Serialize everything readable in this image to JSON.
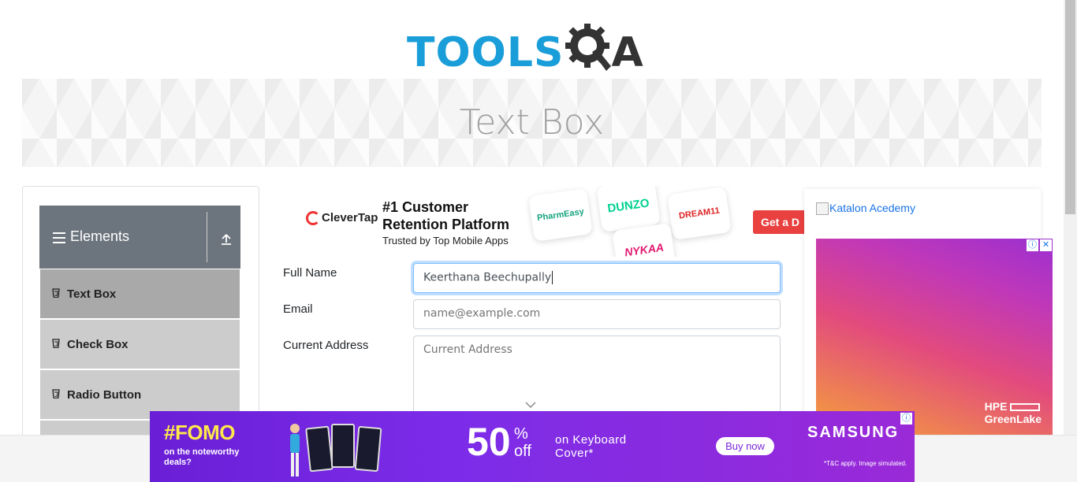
{
  "header": {
    "logo_tools": "TOOLS",
    "logo_qa": "QA",
    "brand_color": "#1a9ed9"
  },
  "banner": {
    "title": "Text Box"
  },
  "sidebar": {
    "group_title": "Elements",
    "items": [
      {
        "label": "Text Box",
        "active": true
      },
      {
        "label": "Check Box",
        "active": false
      },
      {
        "label": "Radio Button",
        "active": false
      }
    ]
  },
  "center_ad": {
    "brand": "CleverTap",
    "headline": "#1 Customer Retention Platform",
    "subline": "Trusted by Top Mobile Apps",
    "tiles": [
      "PharmEasy",
      "DUNZO",
      "DREAM11",
      "NYKAA"
    ],
    "cta": "Get a D"
  },
  "form": {
    "full_name_label": "Full Name",
    "full_name_value": "Keerthana Beechupally",
    "email_label": "Email",
    "email_placeholder": "name@example.com",
    "address_label": "Current Address",
    "address_placeholder": "Current Address"
  },
  "right_ad": {
    "katalon_alt": "Katalon Acedemy",
    "hpe_logo_line1": "HPE",
    "hpe_logo_line2": "GreenLake",
    "info_icon": "ⓘ",
    "close_icon": "✕"
  },
  "bottom_ad": {
    "fomo": "#FOMO",
    "fomo_sub": "on the noteworthy deals?",
    "big_number": "50",
    "pct": "%",
    "off": "off",
    "offer": "on Keyboard Cover*",
    "buy_now": "Buy now",
    "brand": "SAMSUNG",
    "fine_print": "*T&C apply. Image simulated.",
    "info_icon": "ⓘ"
  }
}
